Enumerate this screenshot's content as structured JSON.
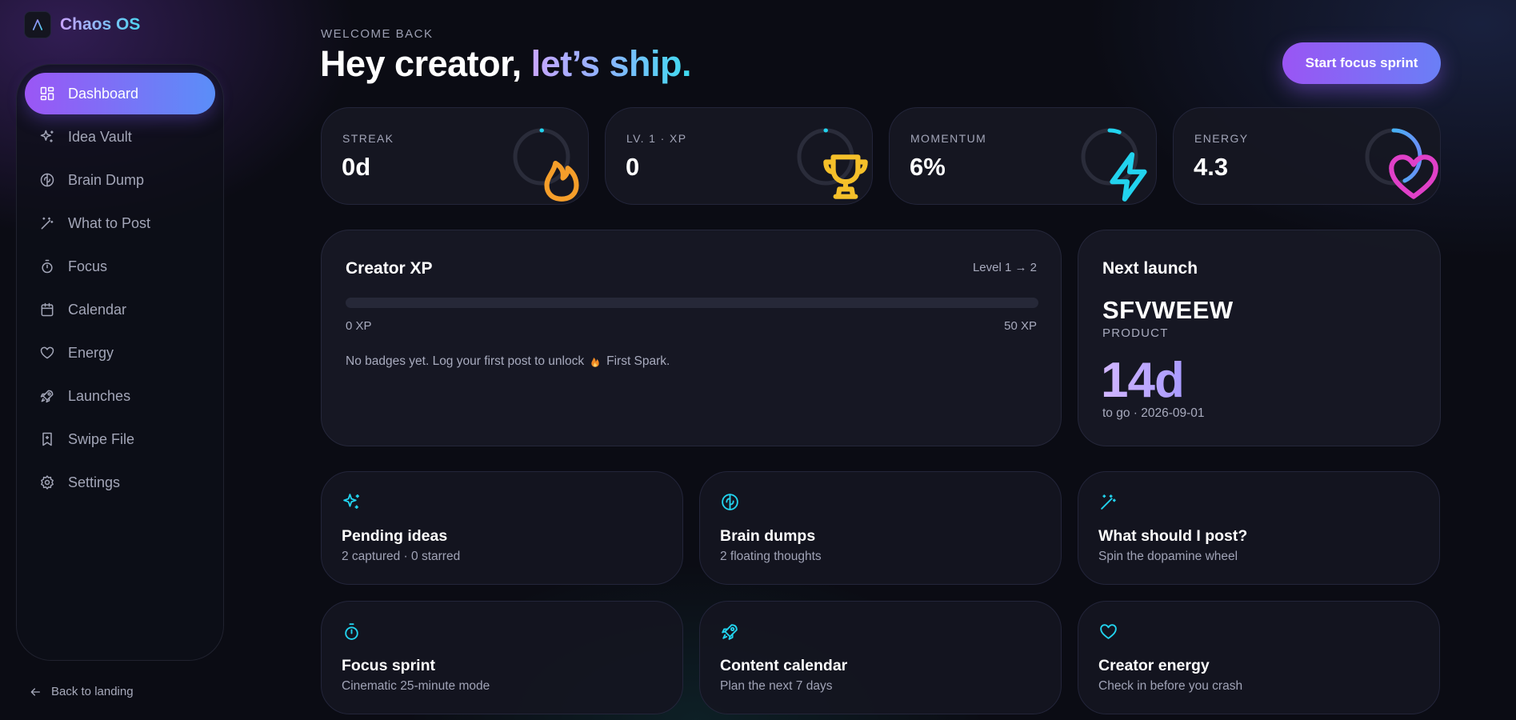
{
  "app": {
    "name": "Chaos OS"
  },
  "sidebar": {
    "items": [
      {
        "label": "Dashboard",
        "icon": "dashboard-icon"
      },
      {
        "label": "Idea Vault",
        "icon": "sparkles-icon"
      },
      {
        "label": "Brain Dump",
        "icon": "brain-icon"
      },
      {
        "label": "What to Post",
        "icon": "wand-icon"
      },
      {
        "label": "Focus",
        "icon": "timer-icon"
      },
      {
        "label": "Calendar",
        "icon": "calendar-icon"
      },
      {
        "label": "Energy",
        "icon": "heart-icon"
      },
      {
        "label": "Launches",
        "icon": "rocket-icon"
      },
      {
        "label": "Swipe File",
        "icon": "bookmark-icon"
      },
      {
        "label": "Settings",
        "icon": "gear-icon"
      }
    ],
    "active_index": 0,
    "back_label": "Back to landing"
  },
  "header": {
    "eyebrow": "WELCOME BACK",
    "greeting": "Hey creator, ",
    "accent": "let’s ship.",
    "cta_label": "Start focus sprint"
  },
  "stats": [
    {
      "label": "STREAK",
      "value": "0d",
      "icon": "flame-icon",
      "progress": 0,
      "color": "#f59e2a"
    },
    {
      "label": "LV. 1 · XP",
      "value": "0",
      "icon": "trophy-icon",
      "progress": 0,
      "color": "#f5c02a"
    },
    {
      "label": "MOMENTUM",
      "value": "6%",
      "icon": "bolt-icon",
      "progress": 0.06,
      "color": "#22d3ee"
    },
    {
      "label": "ENERGY",
      "value": "4.3",
      "icon": "heart-icon",
      "progress": 0.43,
      "color": "#e040c8"
    }
  ],
  "xp_card": {
    "title": "Creator XP",
    "level": "Level 1 → 2",
    "progress": 0,
    "min_label": "0 XP",
    "max_label": "50 XP",
    "note_before": "No badges yet. Log your first post to unlock",
    "note_badge": "First Spark."
  },
  "next_launch": {
    "title": "Next launch",
    "name": "SFVWEEW",
    "type": "PRODUCT",
    "days": "14d",
    "date_line": "to go · 2026-09-01"
  },
  "actions": [
    {
      "title": "Pending ideas",
      "subtitle": "2 captured · 0 starred",
      "icon": "sparkles-icon"
    },
    {
      "title": "Brain dumps",
      "subtitle": "2 floating thoughts",
      "icon": "brain-icon"
    },
    {
      "title": "What should I post?",
      "subtitle": "Spin the dopamine wheel",
      "icon": "wand-icon"
    },
    {
      "title": "Focus sprint",
      "subtitle": "Cinematic 25-minute mode",
      "icon": "timer-icon"
    },
    {
      "title": "Content calendar",
      "subtitle": "Plan the next 7 days",
      "icon": "rocket-icon"
    },
    {
      "title": "Creator energy",
      "subtitle": "Check in before you crash",
      "icon": "heart-icon"
    }
  ],
  "colors": {
    "accent_purple": "#9b56f5",
    "accent_blue": "#5a8ef8",
    "accent_cyan": "#22d3ee",
    "background": "#0b0c14"
  }
}
